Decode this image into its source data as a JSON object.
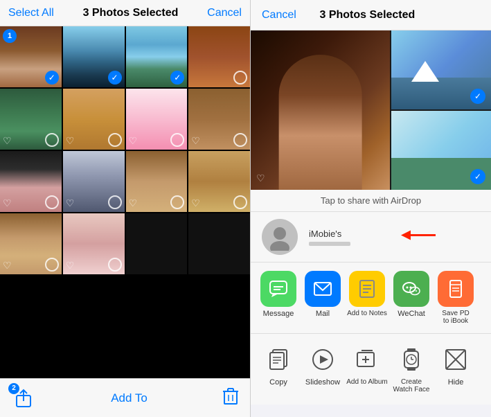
{
  "left": {
    "header": {
      "select_all": "Select All",
      "title": "3 Photos Selected",
      "cancel": "Cancel"
    },
    "photos": [
      {
        "id": 1,
        "class": "photo-person-red",
        "selected": true,
        "badge": "1",
        "heart": false
      },
      {
        "id": 2,
        "class": "photo-mountain",
        "selected": true,
        "heart": false
      },
      {
        "id": 3,
        "class": "photo-beach-mountains",
        "selected": true,
        "heart": false
      },
      {
        "id": 4,
        "class": "photo-meat",
        "selected": false,
        "heart": false
      },
      {
        "id": 5,
        "class": "photo-forest",
        "selected": false,
        "heart": false
      },
      {
        "id": 6,
        "class": "photo-dog-golden",
        "selected": false,
        "heart": false
      },
      {
        "id": 7,
        "class": "photo-anime",
        "selected": false,
        "heart": false
      },
      {
        "id": 8,
        "class": "photo-wood",
        "selected": false,
        "heart": false
      },
      {
        "id": 9,
        "class": "photo-girl-dark",
        "selected": false,
        "heart": false
      },
      {
        "id": 10,
        "class": "photo-husky",
        "selected": false,
        "heart": false
      },
      {
        "id": 11,
        "class": "photo-dog-brown",
        "selected": false,
        "heart": false
      },
      {
        "id": 12,
        "class": "photo-golden2",
        "selected": false,
        "heart": false
      },
      {
        "id": 13,
        "class": "photo-puppy",
        "selected": false,
        "heart": false
      },
      {
        "id": 14,
        "class": "photo-girl-light",
        "selected": false,
        "heart": false
      }
    ],
    "footer": {
      "badge_number": "2",
      "add_to": "Add To"
    }
  },
  "right": {
    "header": {
      "cancel": "Cancel",
      "title": "3 Photos Selected"
    },
    "airdrop_hint": "Tap to share with AirDrop",
    "contact": {
      "name": "iMobie's"
    },
    "share_actions": [
      {
        "id": "message",
        "label": "Message",
        "icon_char": "💬",
        "color": "#4cd964"
      },
      {
        "id": "mail",
        "label": "Mail",
        "icon_char": "✉️",
        "color": "#007aff"
      },
      {
        "id": "notes",
        "label": "Add to Notes",
        "icon_char": "📝",
        "color": "#ffcc00"
      },
      {
        "id": "wechat",
        "label": "WeChat",
        "icon_char": "💬",
        "color": "#4caf50"
      },
      {
        "id": "ibooks",
        "label": "Save PD\nto iBook",
        "icon_char": "📖",
        "color": "#ff6b35"
      }
    ],
    "more_actions": [
      {
        "id": "copy",
        "label": "Copy",
        "icon": "copy"
      },
      {
        "id": "slideshow",
        "label": "Slideshow",
        "icon": "play"
      },
      {
        "id": "add_album",
        "label": "Add to Album",
        "icon": "add_album"
      },
      {
        "id": "watch_face",
        "label": "Create\nWatch Face",
        "icon": "watch"
      },
      {
        "id": "hide",
        "label": "Hide",
        "icon": "hide"
      }
    ]
  }
}
